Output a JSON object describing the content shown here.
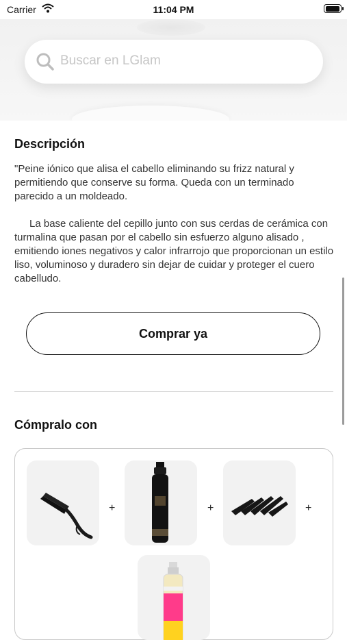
{
  "status_bar": {
    "carrier": "Carrier",
    "time": "11:04 PM"
  },
  "search": {
    "placeholder": "Buscar en LGlam"
  },
  "description": {
    "title": "Descripción",
    "paragraph_1": "\"Peine iónico que alisa el cabello eliminando su frizz natural y permitiendo que conserve su forma. Queda con un terminado parecido a un moldeado.",
    "paragraph_2": "La base caliente del cepillo junto con sus cerdas de cerámica con turmalina que pasan por el cabello sin esfuerzo alguno alisado , emitiendo iones negativos y calor infrarrojo que proporcionan un estilo liso, voluminoso y duradero sin dejar de cuidar y proteger el cuero cabelludo."
  },
  "buy_button": {
    "label": "Comprar ya"
  },
  "bundle": {
    "title": "Cómpralo con",
    "plus": "+",
    "products": [
      {
        "icon": "hair-straightening-brush-image"
      },
      {
        "icon": "hair-serum-bottle-image"
      },
      {
        "icon": "hair-clips-image"
      },
      {
        "icon": "spray-bottle-image"
      }
    ]
  },
  "colors": {
    "accent": "#111111",
    "placeholder": "#c6c6c6",
    "card_border": "#c8c8c8"
  }
}
